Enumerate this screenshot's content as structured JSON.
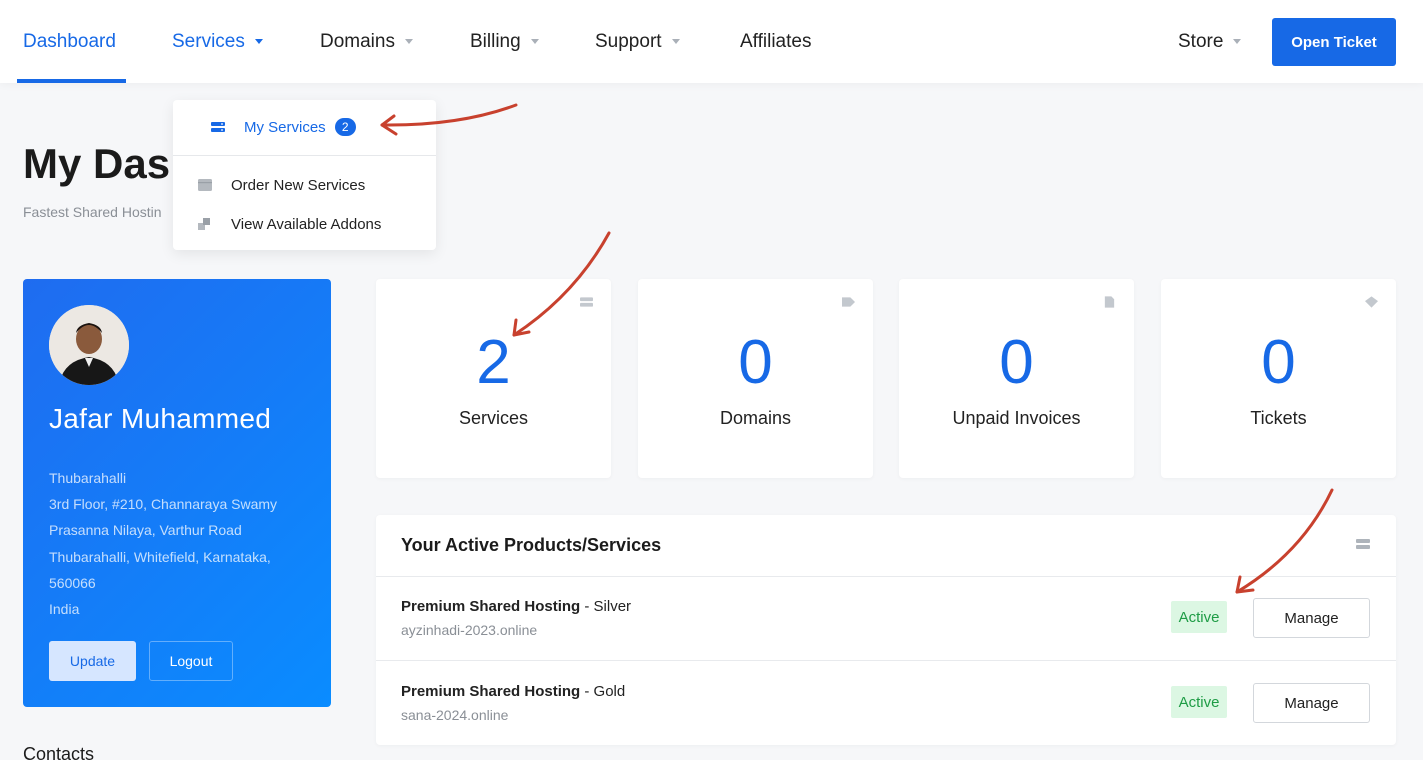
{
  "nav": {
    "dashboard": "Dashboard",
    "services": "Services",
    "domains": "Domains",
    "billing": "Billing",
    "support": "Support",
    "affiliates": "Affiliates",
    "store": "Store",
    "open_ticket": "Open Ticket"
  },
  "dropdown": {
    "my_services": "My Services",
    "my_services_count": "2",
    "order_new": "Order New Services",
    "view_addons": "View Available Addons"
  },
  "page": {
    "title": "My Das",
    "subtitle": "Fastest Shared Hostin"
  },
  "profile": {
    "name": "Jafar Muhammed",
    "address": [
      "Thubarahalli",
      "3rd Floor, #210, Channaraya Swamy",
      "Prasanna Nilaya, Varthur Road",
      "Thubarahalli, Whitefield, Karnataka,",
      "560066",
      "India"
    ],
    "update_label": "Update",
    "logout_label": "Logout"
  },
  "contacts_heading": "Contacts",
  "stats": [
    {
      "value": "2",
      "label": "Services",
      "icon": "server-icon"
    },
    {
      "value": "0",
      "label": "Domains",
      "icon": "tag-icon"
    },
    {
      "value": "0",
      "label": "Unpaid Invoices",
      "icon": "document-icon"
    },
    {
      "value": "0",
      "label": "Tickets",
      "icon": "ticket-icon"
    }
  ],
  "products": {
    "title": "Your Active Products/Services",
    "items": [
      {
        "product": "Premium Shared Hosting",
        "plan": " - Silver",
        "domain": "ayzinhadi-2023.online",
        "status": "Active",
        "action": "Manage"
      },
      {
        "product": "Premium Shared Hosting",
        "plan": " - Gold",
        "domain": "sana-2024.online",
        "status": "Active",
        "action": "Manage"
      }
    ]
  },
  "colors": {
    "accent": "#1769e6",
    "status_active_bg": "#dcf7e3",
    "status_active_text": "#1e9c45",
    "annotation_arrow": "#c8412e"
  }
}
